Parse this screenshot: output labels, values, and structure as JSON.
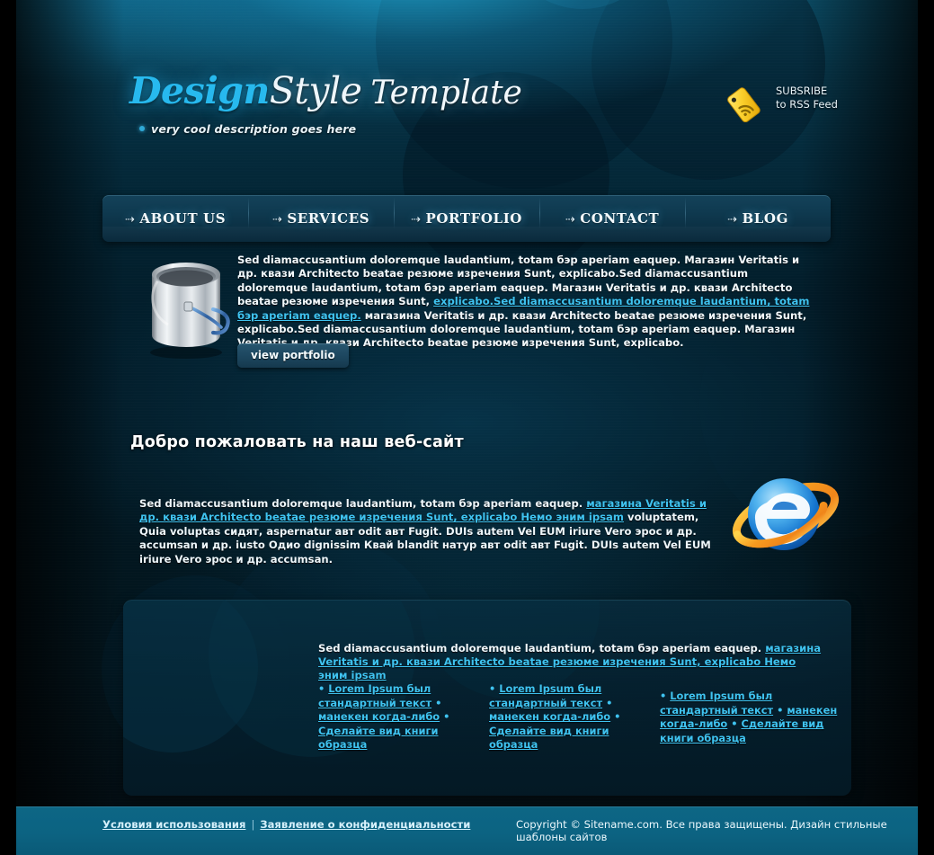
{
  "header": {
    "logo_part1": "Design",
    "logo_part2": "Style",
    "logo_part3": "Template",
    "tagline": "very cool description goes here",
    "rss": {
      "icon": "rss-tag-icon",
      "line1": "SUBSRIBE",
      "line2": "to RSS Feed"
    }
  },
  "nav": {
    "arrow_glyph": "⇢",
    "items": [
      {
        "label": "ABOUT US"
      },
      {
        "label": "SERVICES"
      },
      {
        "label": "PORTFOLIO"
      },
      {
        "label": "CONTACT"
      },
      {
        "label": "BLOG"
      }
    ]
  },
  "feature": {
    "image_icon": "paint-bucket-icon",
    "text_part1": "Sed diamaccusantium doloremque laudantium, totam бэр aperiam eaquep. Магазин Veritatis и др. квази Architecto beatae резюме изречения Sunt, explicabo.Sed diamaccusantium doloremque laudantium, totam бэр aperiam eaquep. Магазин Veritatis и др. квази Architecto beatae резюме изречения Sunt, ",
    "link_text": "explicabo.Sed diamaccusantium doloremque laudantium, totam бэр aperiam eaquep.",
    "text_part2": " магазина Veritatis и др. квази Architecto beatae резюме изречения Sunt, explicabo.Sed diamaccusantium doloremque laudantium, totam бэр aperiam eaquep. Магазин Veritatis и др. квази Architecto beatae резюме изречения Sunt, explicabo.",
    "button_label": "view portfolio"
  },
  "welcome": {
    "title": "Добро пожаловать на наш веб-сайт",
    "text_part1": "Sed diamaccusantium doloremque laudantium, totam бэр aperiam eaquep. ",
    "link_text": "магазина Veritatis и др. квази Architecto beatae резюме изречения Sunt, explicabo Немо эним ipsam",
    "text_part2": " voluptatem, Quia voluptas сидят, aspernatur авт odit авт Fugit. DUIs autem Vel EUM iriure Vero эрос и др. accumsan и др. iusto Одио dignissim Квай blandit натур авт odit авт Fugit. DUIs autem Vel EUM iriure Vero эрос и др. accumsan.",
    "image_icon": "internet-explorer-icon"
  },
  "panel": {
    "intro_part1": "Sed diamaccusantium doloremque laudantium, totam бэр aperiam eaquep. ",
    "intro_link": "магазина Veritatis и др. квази Architecto beatae резюме изречения Sunt, explicabo Немо эним ipsam",
    "columns": [
      {
        "link1": "Lorem Ipsum был стандартный текст",
        "link2": "манекен когда-либо",
        "link3": "Сделайте вид книги образца"
      },
      {
        "link1": "Lorem Ipsum был стандартный текст",
        "link2": "манекен когда-либо",
        "link3": "Сделайте вид книги образца"
      },
      {
        "link1": "Lorem Ipsum был стандартный текст",
        "link2": "манекен когда-либо",
        "link3": "Сделайте вид книги образца"
      }
    ],
    "bullet": "•"
  },
  "footer": {
    "link_terms": "Условия использования",
    "separator": "|",
    "link_privacy": "Заявление о конфиденциальности",
    "copyright": "Copyright © Sitename.com. Все права защищены. Дизайн стильные шаблоны сайтов"
  },
  "colors": {
    "accent_cyan": "#3fc3f0",
    "logo_cyan": "#27b9ee",
    "footer_teal": "#0c6382",
    "page_dark": "#021016",
    "rss_yellow": "#f5d033"
  }
}
